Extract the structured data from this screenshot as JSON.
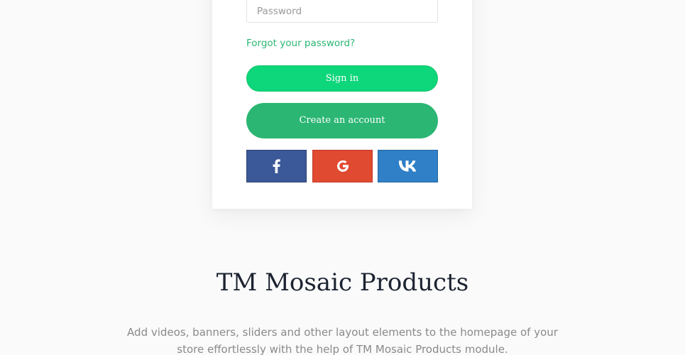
{
  "login": {
    "password_placeholder": "Password",
    "forgot_label": "Forgot your password?",
    "signin_label": "Sign in",
    "create_label": "Create an account"
  },
  "social": {
    "facebook_icon": "facebook-icon",
    "google_icon": "google-icon",
    "vk_icon": "vk-icon"
  },
  "colors": {
    "accent": "#2bb673",
    "signin": "#0ed67a",
    "facebook": "#3b5998",
    "google": "#e04a30",
    "vk": "#2f80c6",
    "title": "#1c2331",
    "description": "#8a8a8a"
  },
  "section": {
    "title": "TM Mosaic Products",
    "description": "Add videos, banners, sliders and other layout elements to the homepage of your store effortlessly with the help of TM Mosaic Products module."
  }
}
